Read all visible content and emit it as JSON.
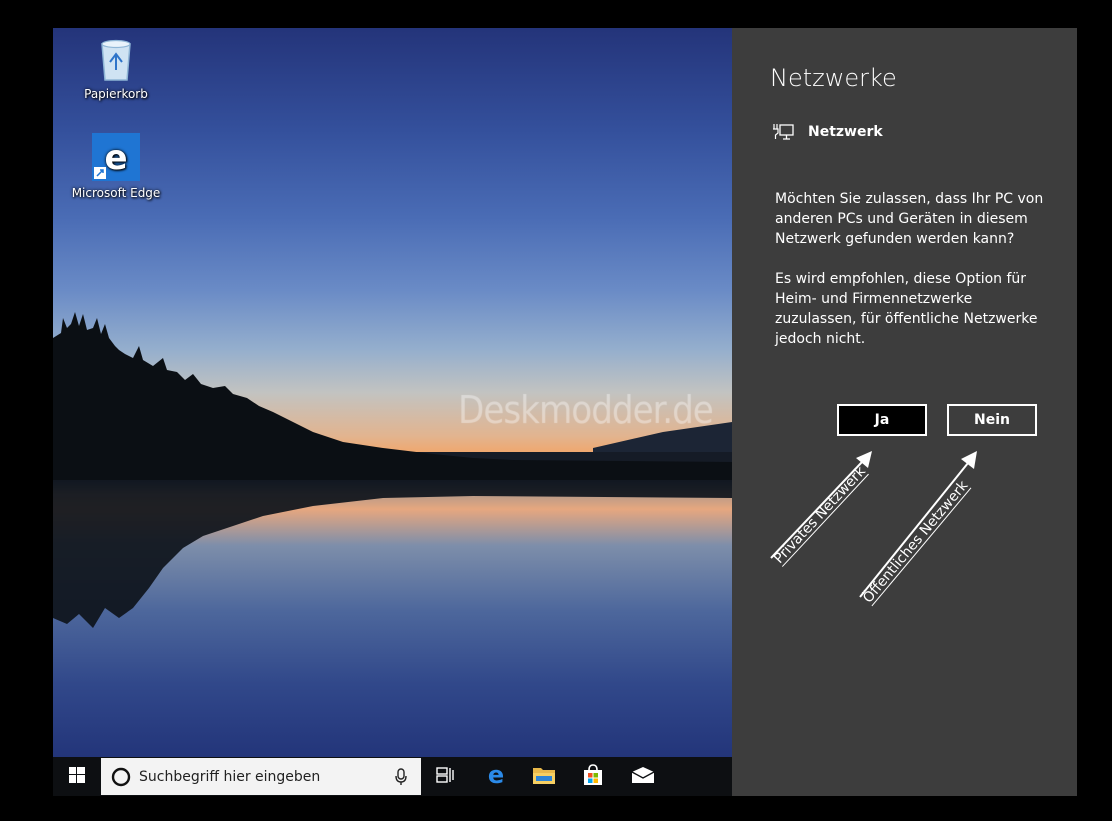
{
  "desktop": {
    "icons": [
      {
        "label": "Papierkorb",
        "icon": "recycle-bin-icon"
      },
      {
        "label": "Microsoft Edge",
        "icon": "edge-icon"
      }
    ],
    "watermark": "Deskmodder.de"
  },
  "taskbar": {
    "search_placeholder": "Suchbegriff hier eingeben",
    "icons": [
      "windows-start-icon",
      "cortana-icon",
      "microphone-icon",
      "task-view-icon",
      "edge-icon",
      "file-explorer-icon",
      "store-icon",
      "mail-icon"
    ]
  },
  "panel": {
    "title": "Netzwerke",
    "network_name": "Netzwerk",
    "question": "Möchten Sie zulassen, dass Ihr PC von anderen PCs und Geräten in diesem Netzwerk gefunden werden kann?",
    "recommendation": "Es wird empfohlen, diese Option für Heim- und Firmennetzwerke zuzulassen, für öffentliche Netzwerke jedoch nicht.",
    "yes_label": "Ja",
    "no_label": "Nein",
    "background": "#3d3d3d"
  },
  "annotations": {
    "private": "Privates Netzwerk",
    "public": "Öffentliches Netzwerk"
  }
}
